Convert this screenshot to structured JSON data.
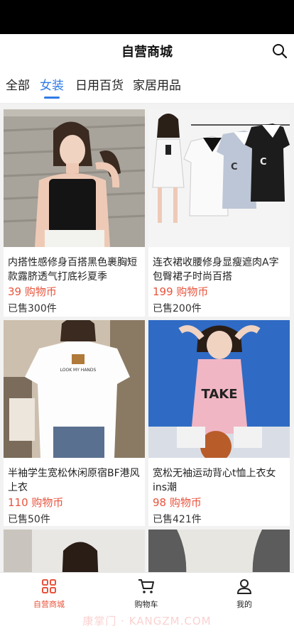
{
  "header": {
    "title": "自营商城"
  },
  "tabs": [
    {
      "label": "全部",
      "active": false
    },
    {
      "label": "女装",
      "active": true
    },
    {
      "label": "日用百货",
      "active": false
    },
    {
      "label": "家居用品",
      "active": false
    }
  ],
  "products": [
    {
      "name": "内搭性感修身百搭黑色裹胸短款露脐透气打底衫夏季",
      "price": "39 购物币",
      "sold": "已售300件"
    },
    {
      "name": "连衣裙收腰修身显瘦遮肉A字包臀裙子时尚百搭",
      "price": "199 购物币",
      "sold": "已售200件"
    },
    {
      "name": "半袖学生宽松休闲原宿BF港风上衣",
      "price": "110 购物币",
      "sold": "已售50件"
    },
    {
      "name": "宽松无袖运动背心t恤上衣女ins潮",
      "price": "98 购物币",
      "sold": "已售421件"
    },
    {
      "name": "",
      "price": "",
      "sold": ""
    },
    {
      "name": "",
      "price": "",
      "sold": ""
    }
  ],
  "product_image_text": {
    "tee_print": "LOOK MY HANDS",
    "tank_print": "TAKE",
    "dress_letter": "C"
  },
  "bottom_nav": [
    {
      "label": "自营商城",
      "icon": "grid-icon",
      "active": true
    },
    {
      "label": "购物车",
      "icon": "cart-icon",
      "active": false
    },
    {
      "label": "我的",
      "icon": "user-icon",
      "active": false
    }
  ],
  "watermark": "康掌门 · KANGZM.COM",
  "colors": {
    "accent_tab": "#2f7be6",
    "price": "#e8543d",
    "active_nav": "#e8543d"
  }
}
